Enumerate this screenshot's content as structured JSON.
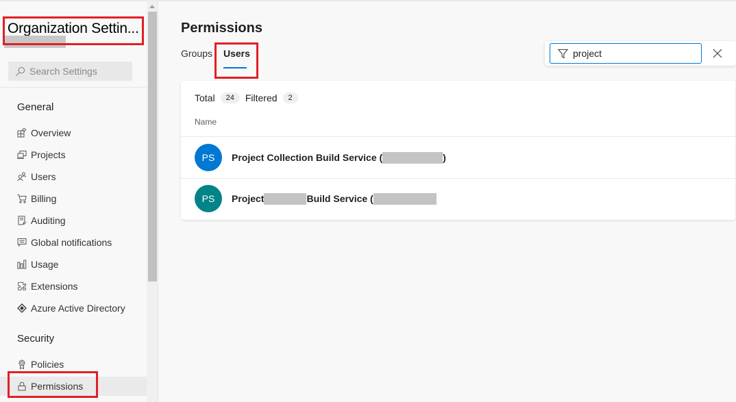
{
  "sidebar": {
    "title": "Organization Settin...",
    "search_placeholder": "Search Settings",
    "sections": [
      {
        "title": "General",
        "items": [
          {
            "label": "Overview",
            "icon": "overview-icon"
          },
          {
            "label": "Projects",
            "icon": "projects-icon"
          },
          {
            "label": "Users",
            "icon": "users-icon"
          },
          {
            "label": "Billing",
            "icon": "cart-icon"
          },
          {
            "label": "Auditing",
            "icon": "auditing-icon"
          },
          {
            "label": "Global notifications",
            "icon": "notification-icon"
          },
          {
            "label": "Usage",
            "icon": "usage-icon"
          },
          {
            "label": "Extensions",
            "icon": "extensions-icon"
          },
          {
            "label": "Azure Active Directory",
            "icon": "azure-ad-icon"
          }
        ]
      },
      {
        "title": "Security",
        "items": [
          {
            "label": "Policies",
            "icon": "policy-icon"
          },
          {
            "label": "Permissions",
            "icon": "lock-icon",
            "selected": true
          }
        ]
      }
    ]
  },
  "main": {
    "title": "Permissions",
    "tabs": [
      {
        "label": "Groups",
        "active": false
      },
      {
        "label": "Users",
        "active": true
      }
    ],
    "filter": {
      "value": "project",
      "icon": "filter-icon",
      "clear_icon": "close-icon"
    },
    "counts": {
      "total_label": "Total",
      "total_value": "24",
      "filtered_label": "Filtered",
      "filtered_value": "2"
    },
    "column_header": "Name",
    "rows": [
      {
        "initials": "PS",
        "avatar_color": "#0078d4",
        "name_prefix": "Project Collection Build Service (",
        "name_suffix": ")"
      },
      {
        "initials": "PS",
        "avatar_color": "#038387",
        "name_prefix": "Project",
        "name_middle": "Build Service (",
        "name_suffix": ""
      }
    ]
  },
  "colors": {
    "accent": "#0078d4",
    "highlight_box": "#e21e26",
    "avatar_teal": "#038387"
  }
}
